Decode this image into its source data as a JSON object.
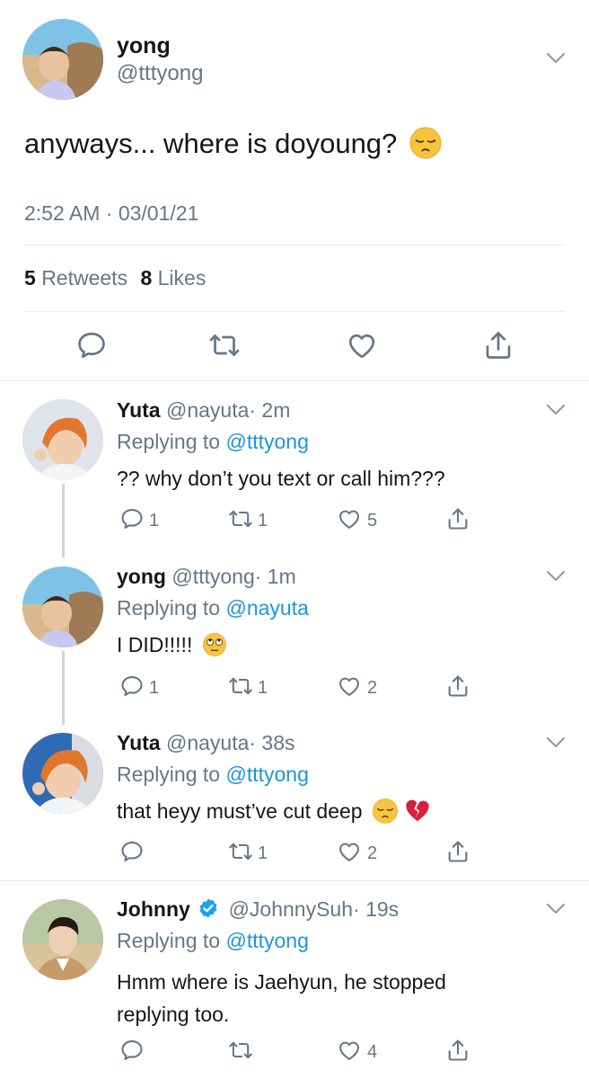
{
  "main_tweet": {
    "name": "yong",
    "handle": "@tttyong",
    "text": "anyways... where is doyoung?",
    "timestamp": "2:52 AM · 03/01/21",
    "retweets_count": "5",
    "retweets_label": "Retweets",
    "likes_count": "8",
    "likes_label": "Likes"
  },
  "replies": [
    {
      "name": "Yuta",
      "handle": "@nayuta",
      "time": "· 2m",
      "replying_label": "Replying to",
      "replying_to": "@tttyong",
      "text": "?? why don’t you text or call him???",
      "reply_count": "1",
      "retweet_count": "1",
      "like_count": "5"
    },
    {
      "name": "yong",
      "handle": "@tttyong",
      "time": "· 1m",
      "replying_label": "Replying to",
      "replying_to": "@nayuta",
      "text": "I DID!!!!!",
      "reply_count": "1",
      "retweet_count": "1",
      "like_count": "2"
    },
    {
      "name": "Yuta",
      "handle": "@nayuta",
      "time": "· 38s",
      "replying_label": "Replying to",
      "replying_to": "@tttyong",
      "text": "that heyy must’ve cut deep",
      "reply_count": "",
      "retweet_count": "1",
      "like_count": "2"
    },
    {
      "name": "Johnny",
      "handle": "@JohnnySuh",
      "time": "· 19s",
      "replying_label": "Replying to",
      "replying_to": "@tttyong",
      "text_line1": "Hmm where is Jaehyun, he stopped",
      "text_line2": "replying too.",
      "reply_count": "",
      "retweet_count": "",
      "like_count": "4"
    }
  ],
  "colors": {
    "text": "#14171a",
    "muted": "#657786",
    "link": "#1b95e0",
    "divider": "#e6ecf0",
    "thread_line": "#ccd6dd",
    "verified": "#1da1f2"
  },
  "icons": [
    "chevron-down-icon",
    "reply-icon",
    "retweet-icon",
    "like-icon",
    "share-icon",
    "verified-badge-icon",
    "pensive-emoji",
    "eye-roll-emoji",
    "broken-heart-emoji"
  ]
}
